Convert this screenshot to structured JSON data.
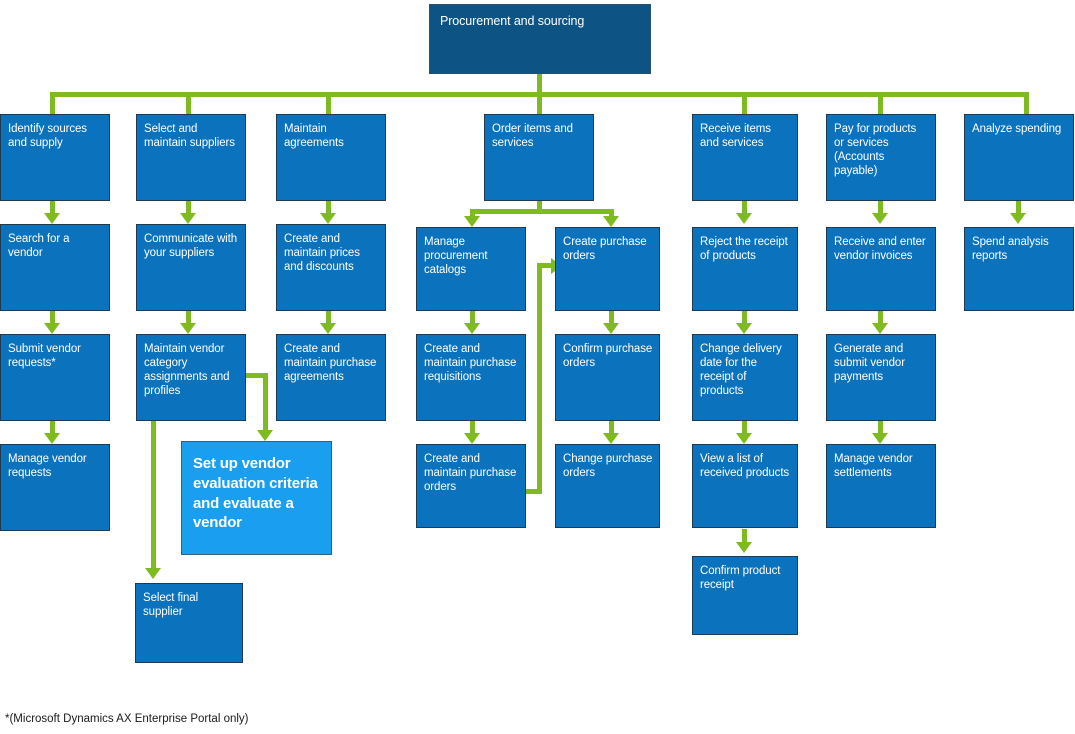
{
  "diagram": {
    "title": "Procurement and sourcing",
    "accent_box_color": "#0b72bd",
    "root_box_color": "#0d5384",
    "highlight_box_color": "#199ef0",
    "connector_color": "#7fba20",
    "text_color": "#ffffff",
    "footnote": "*(Microsoft Dynamics AX Enterprise Portal only)"
  },
  "nodes": {
    "root": "Procurement and sourcing",
    "col1": {
      "n1": "Identify sources and supply",
      "n2": "Search for a vendor",
      "n3": "Submit vendor requests*",
      "n4": "Manage vendor requests"
    },
    "col2": {
      "n1": "Select and maintain suppliers",
      "n2": "Communicate with your suppliers",
      "n3": "Maintain vendor category assignments and profiles",
      "n4": "Select final supplier"
    },
    "col3": {
      "n1": "Maintain agreements",
      "n2": "Create and maintain prices and discounts",
      "n3": "Create and maintain purchase agreements",
      "n4": "Set up vendor evaluation criteria and evaluate a vendor"
    },
    "col4": {
      "n1": "Order items and services",
      "n2": "Manage procurement catalogs",
      "n3": "Create and maintain purchase requisitions",
      "n4": "Create and maintain purchase orders"
    },
    "col5": {
      "n1": "Create purchase orders",
      "n2": "Confirm  purchase orders",
      "n3": "Change purchase orders"
    },
    "col6": {
      "n1": "Receive items and services",
      "n2": "Reject the receipt of products",
      "n3": "Change delivery date for the receipt of products",
      "n4": "View a list of received products",
      "n5": "Confirm  product receipt"
    },
    "col7": {
      "n1": "Pay for products or services (Accounts payable)",
      "n2": "Receive and enter vendor invoices",
      "n3": "Generate and submit vendor payments",
      "n4": "Manage vendor settlements"
    },
    "col8": {
      "n1": "Analyze spending",
      "n2": "Spend analysis reports"
    }
  }
}
